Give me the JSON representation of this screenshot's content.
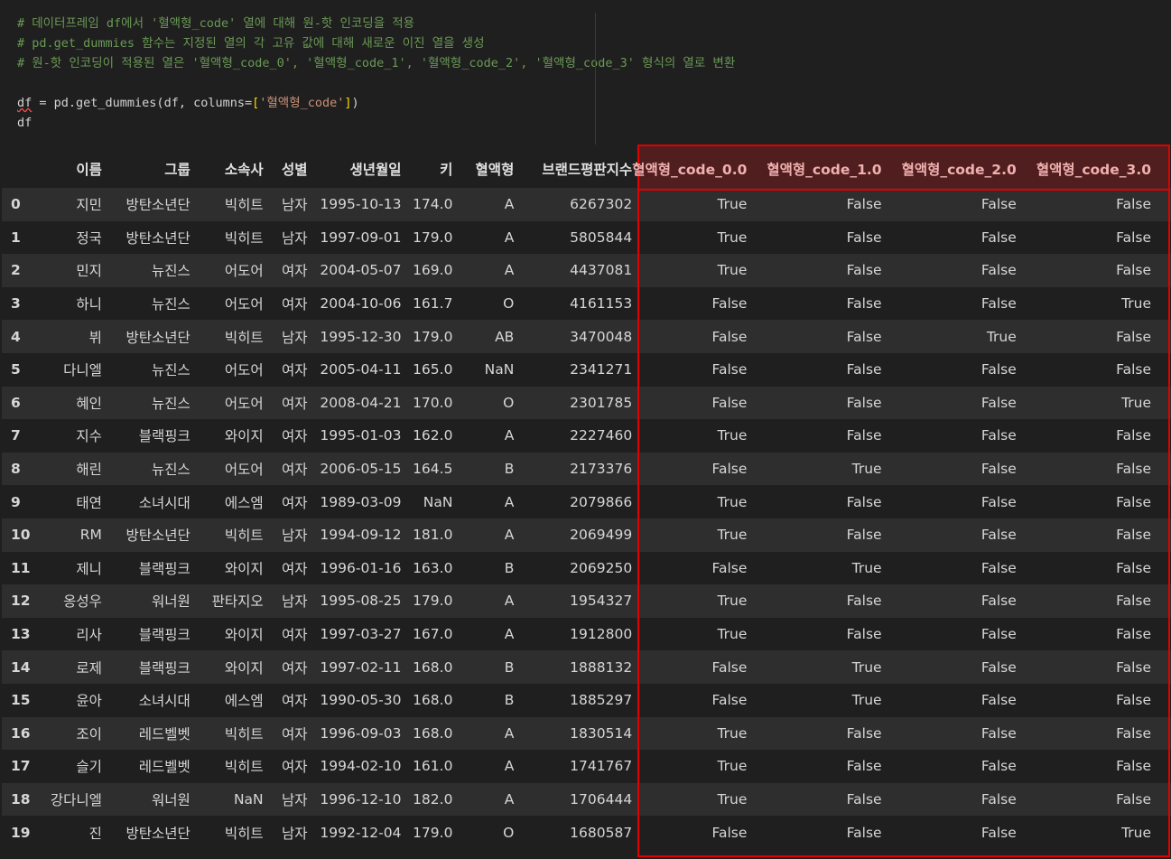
{
  "code": {
    "comment1": "# 데이터프레임 df에서 '혈액형_code' 열에 대해 원-핫 인코딩을 적용",
    "comment2": "# pd.get_dummies 함수는 지정된 열의 각 고유 값에 대해 새로운 이진 열을 생성",
    "comment3": "# 원-핫 인코딩이 적용된 열은 '혈액형_code_0', '혈액형_code_1', '혈액형_code_2', '혈액형_code_3' 형식의 열로 변환",
    "line4_var": "df",
    "line4_mid": " = pd.get_dummies(df, columns=",
    "line4_open": "[",
    "line4_str": "'혈액형_code'",
    "line4_close": "]",
    "line4_end": ")",
    "line5": "df"
  },
  "table": {
    "columns": [
      "",
      "이름",
      "그룹",
      "소속사",
      "성별",
      "생년월일",
      "키",
      "혈액형",
      "브랜드평판지수",
      "혈액형_code_0.0",
      "혈액형_code_1.0",
      "혈액형_code_2.0",
      "혈액형_code_3.0"
    ],
    "rows": [
      [
        "0",
        "지민",
        "방탄소년단",
        "빅히트",
        "남자",
        "1995-10-13",
        "174.0",
        "A",
        "6267302",
        "True",
        "False",
        "False",
        "False"
      ],
      [
        "1",
        "정국",
        "방탄소년단",
        "빅히트",
        "남자",
        "1997-09-01",
        "179.0",
        "A",
        "5805844",
        "True",
        "False",
        "False",
        "False"
      ],
      [
        "2",
        "민지",
        "뉴진스",
        "어도어",
        "여자",
        "2004-05-07",
        "169.0",
        "A",
        "4437081",
        "True",
        "False",
        "False",
        "False"
      ],
      [
        "3",
        "하니",
        "뉴진스",
        "어도어",
        "여자",
        "2004-10-06",
        "161.7",
        "O",
        "4161153",
        "False",
        "False",
        "False",
        "True"
      ],
      [
        "4",
        "뷔",
        "방탄소년단",
        "빅히트",
        "남자",
        "1995-12-30",
        "179.0",
        "AB",
        "3470048",
        "False",
        "False",
        "True",
        "False"
      ],
      [
        "5",
        "다니엘",
        "뉴진스",
        "어도어",
        "여자",
        "2005-04-11",
        "165.0",
        "NaN",
        "2341271",
        "False",
        "False",
        "False",
        "False"
      ],
      [
        "6",
        "혜인",
        "뉴진스",
        "어도어",
        "여자",
        "2008-04-21",
        "170.0",
        "O",
        "2301785",
        "False",
        "False",
        "False",
        "True"
      ],
      [
        "7",
        "지수",
        "블랙핑크",
        "와이지",
        "여자",
        "1995-01-03",
        "162.0",
        "A",
        "2227460",
        "True",
        "False",
        "False",
        "False"
      ],
      [
        "8",
        "해린",
        "뉴진스",
        "어도어",
        "여자",
        "2006-05-15",
        "164.5",
        "B",
        "2173376",
        "False",
        "True",
        "False",
        "False"
      ],
      [
        "9",
        "태연",
        "소녀시대",
        "에스엠",
        "여자",
        "1989-03-09",
        "NaN",
        "A",
        "2079866",
        "True",
        "False",
        "False",
        "False"
      ],
      [
        "10",
        "RM",
        "방탄소년단",
        "빅히트",
        "남자",
        "1994-09-12",
        "181.0",
        "A",
        "2069499",
        "True",
        "False",
        "False",
        "False"
      ],
      [
        "11",
        "제니",
        "블랙핑크",
        "와이지",
        "여자",
        "1996-01-16",
        "163.0",
        "B",
        "2069250",
        "False",
        "True",
        "False",
        "False"
      ],
      [
        "12",
        "옹성우",
        "워너원",
        "판타지오",
        "남자",
        "1995-08-25",
        "179.0",
        "A",
        "1954327",
        "True",
        "False",
        "False",
        "False"
      ],
      [
        "13",
        "리사",
        "블랙핑크",
        "와이지",
        "여자",
        "1997-03-27",
        "167.0",
        "A",
        "1912800",
        "True",
        "False",
        "False",
        "False"
      ],
      [
        "14",
        "로제",
        "블랙핑크",
        "와이지",
        "여자",
        "1997-02-11",
        "168.0",
        "B",
        "1888132",
        "False",
        "True",
        "False",
        "False"
      ],
      [
        "15",
        "윤아",
        "소녀시대",
        "에스엠",
        "여자",
        "1990-05-30",
        "168.0",
        "B",
        "1885297",
        "False",
        "True",
        "False",
        "False"
      ],
      [
        "16",
        "조이",
        "레드벨벳",
        "빅히트",
        "여자",
        "1996-09-03",
        "168.0",
        "A",
        "1830514",
        "True",
        "False",
        "False",
        "False"
      ],
      [
        "17",
        "슬기",
        "레드벨벳",
        "빅히트",
        "여자",
        "1994-02-10",
        "161.0",
        "A",
        "1741767",
        "True",
        "False",
        "False",
        "False"
      ],
      [
        "18",
        "강다니엘",
        "워너원",
        "NaN",
        "남자",
        "1996-12-10",
        "182.0",
        "A",
        "1706444",
        "True",
        "False",
        "False",
        "False"
      ],
      [
        "19",
        "진",
        "방탄소년단",
        "빅히트",
        "남자",
        "1992-12-04",
        "179.0",
        "O",
        "1680587",
        "False",
        "False",
        "False",
        "True"
      ]
    ]
  },
  "colors": {
    "highlight": "#e00000",
    "comment": "#6a9955",
    "string": "#ce9178"
  }
}
